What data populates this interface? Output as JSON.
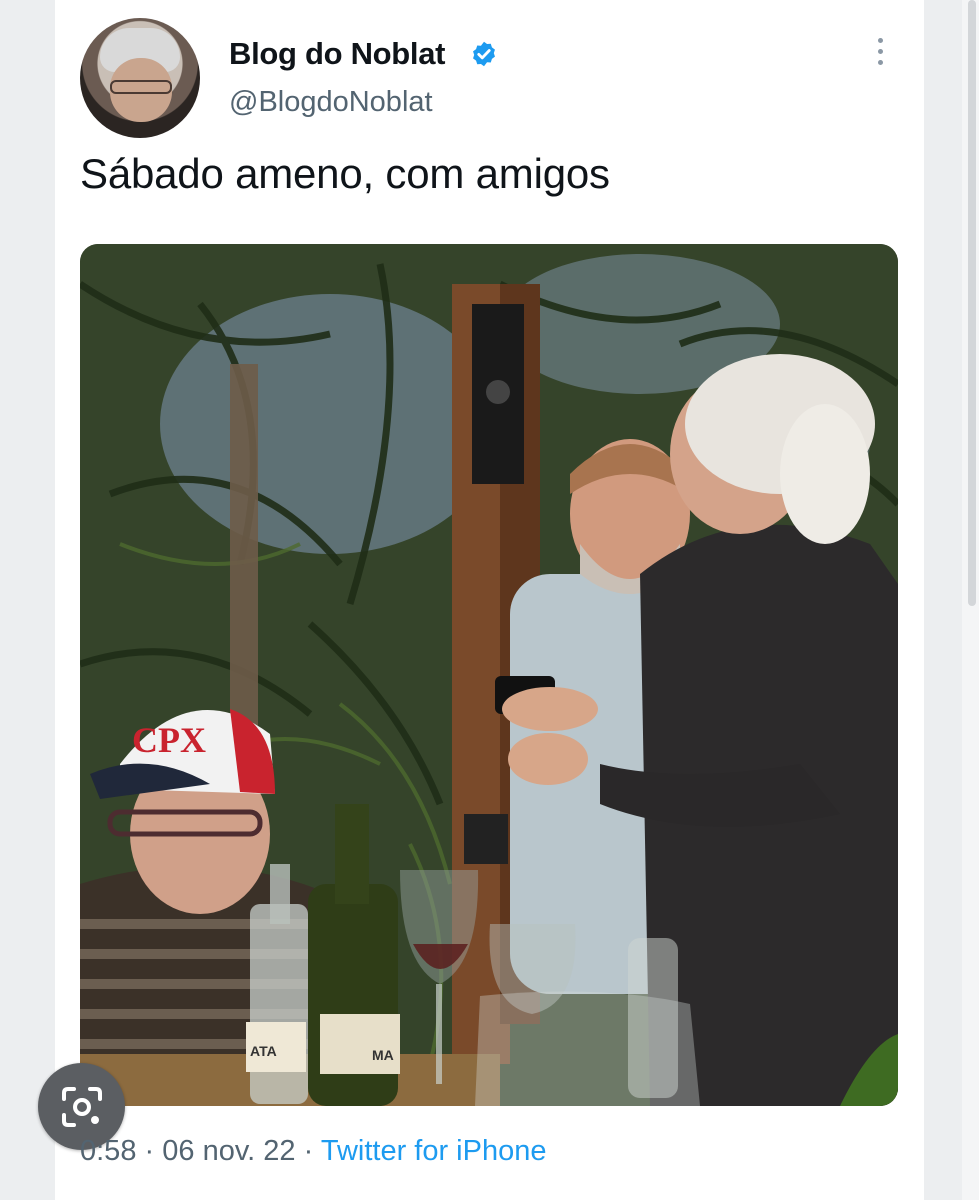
{
  "tweet": {
    "display_name": "Blog do Noblat",
    "handle": "@BlogdoNoblat",
    "verified": true,
    "text": "Sábado ameno, com amigos",
    "time": "0:58",
    "separator": "·",
    "date": "06 nov. 22",
    "source": "Twitter for iPhone",
    "media": {
      "cap_text": "CPX",
      "bottle_label_left": "ATA",
      "bottle_label_right": "MA"
    }
  },
  "icons": {
    "verified": "verified-badge-icon",
    "more": "more-options-icon",
    "lens": "visual-search-icon"
  },
  "colors": {
    "name": "#0f1419",
    "secondary": "#536471",
    "link": "#1d9bf0",
    "verified": "#1d9bf0"
  }
}
